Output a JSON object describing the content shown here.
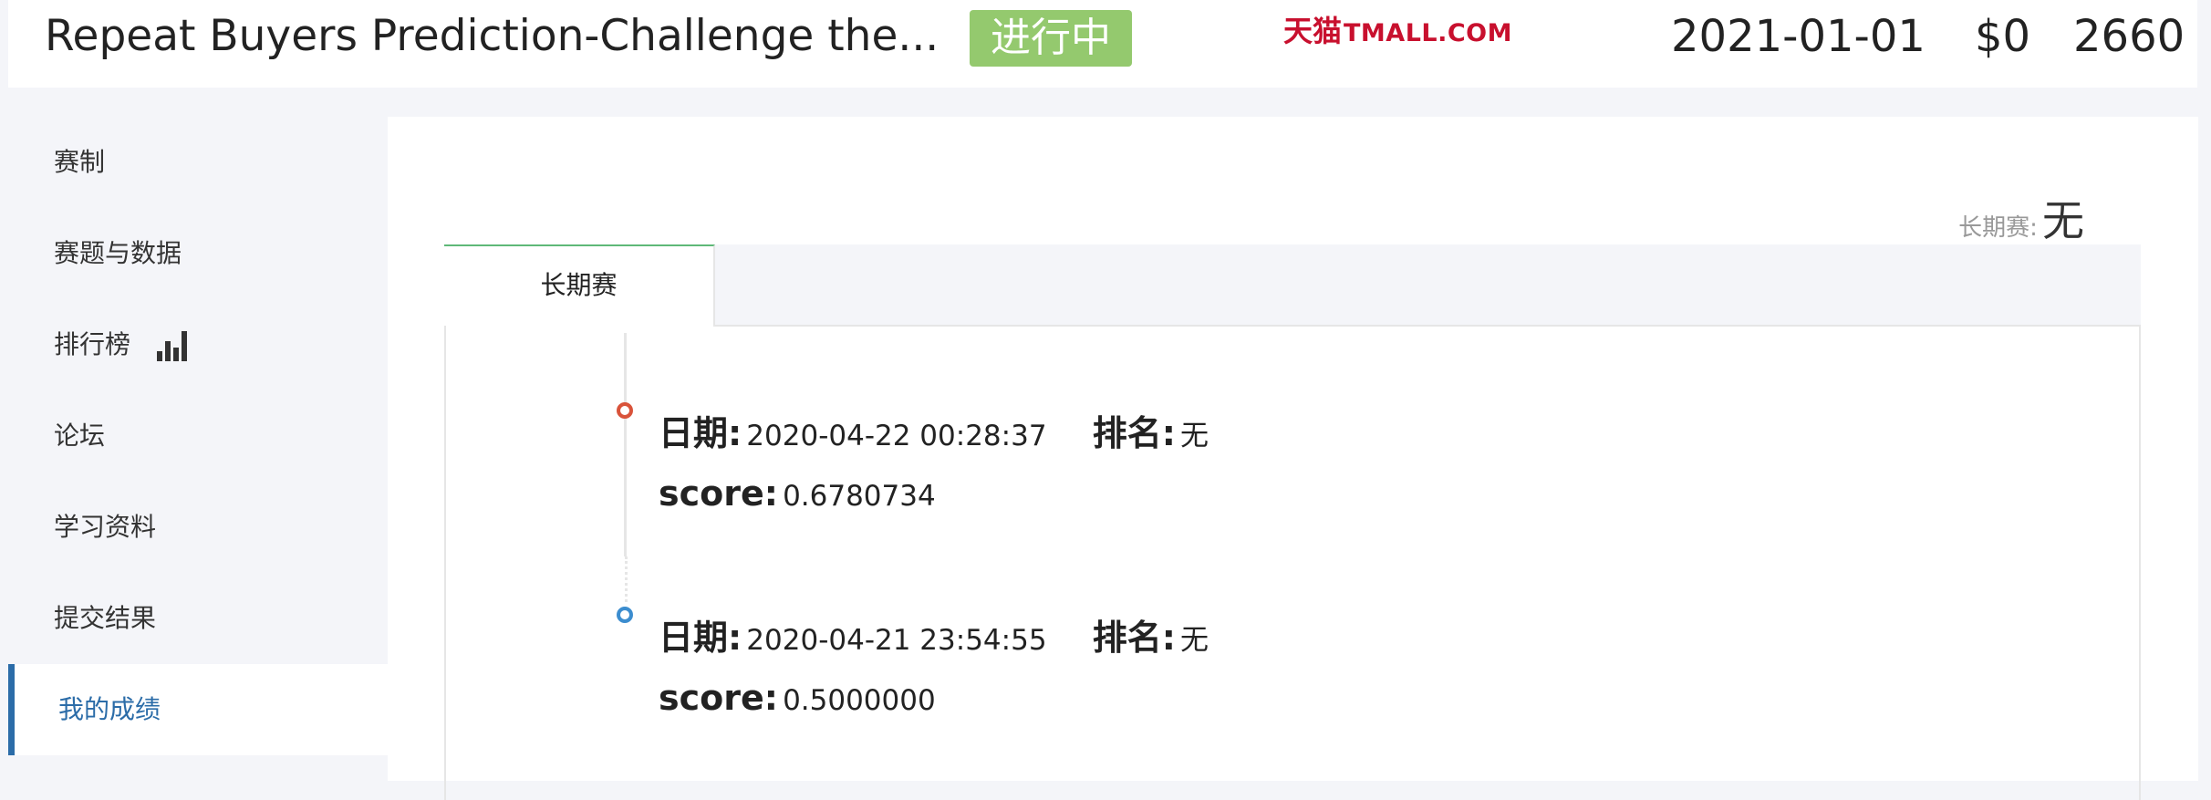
{
  "header": {
    "title": "Repeat Buyers Prediction-Challenge the...",
    "status": "进行中",
    "sponsor_cn": "天猫",
    "sponsor_en": "TMALL.COM",
    "deadline": "2021-01-01",
    "prize": "$0",
    "teams": "2660"
  },
  "sidebar": {
    "items": [
      {
        "label": "赛制"
      },
      {
        "label": "赛题与数据"
      },
      {
        "label": "排行榜",
        "icon": "bar-chart-icon"
      },
      {
        "label": "论坛"
      },
      {
        "label": "学习资料"
      },
      {
        "label": "提交结果"
      },
      {
        "label": "我的成绩",
        "active": true
      }
    ]
  },
  "main": {
    "long_term_label": "长期赛:",
    "long_term_value": "无",
    "tabs": [
      {
        "label": "长期赛",
        "active": true
      }
    ],
    "records": [
      {
        "date_label": "日期:",
        "date": "2020-04-22 00:28:37",
        "rank_label": "排名:",
        "rank": "无",
        "score_label": "score:",
        "score": "0.6780734",
        "dot_color": "#d9533a"
      },
      {
        "date_label": "日期:",
        "date": "2020-04-21 23:54:55",
        "rank_label": "排名:",
        "rank": "无",
        "score_label": "score:",
        "score": "0.5000000",
        "dot_color": "#3c8dcf"
      }
    ]
  },
  "colors": {
    "status_badge": "#94c96e",
    "active_nav": "#2b6ca8",
    "tab_accent": "#5fb878",
    "sponsor": "#c8102e"
  }
}
